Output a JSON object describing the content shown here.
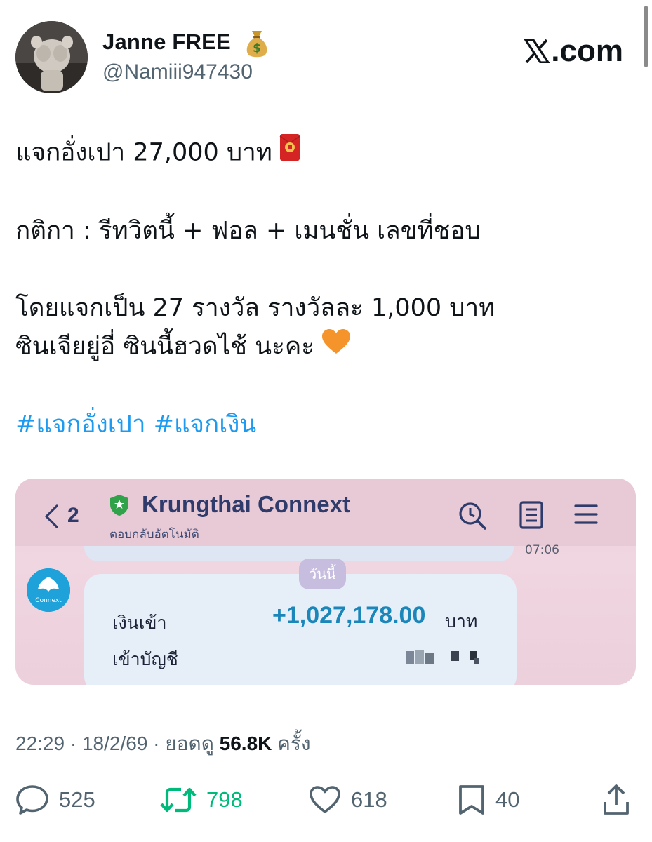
{
  "author": {
    "name": "Janne FREE",
    "name_emoji": "money-bag-icon",
    "handle": "@Namiii947430"
  },
  "brand": {
    "text": ".com",
    "logo": "x-logo-icon"
  },
  "tweet": {
    "line1": "แจกอั่งเปา 27,000 บาท",
    "line1_emoji": "red-envelope-icon",
    "line2": "กติกา : รีทวิตนี้ + ฟอล + เมนชั่น เลขที่ชอบ",
    "line3": "โดยแจกเป็น 27 รางวัล รางวัลละ 1,000 บาท",
    "line4": "ซินเจียยู่อี่ ซินนี้ฮวดไช้ นะคะ",
    "line4_emoji": "orange-heart-icon",
    "hashtags": "#แจกอั่งเปา #แจกเงิน"
  },
  "media": {
    "back_count": "2",
    "app_name": "Krungthai Connext",
    "app_subtitle": "ตอบกลับอัตโนมัติ",
    "time_partial": "07:06",
    "today_label": "วันนี้",
    "bot_label": "Connext",
    "deposit_label": "เงินเข้า",
    "amount": "+1,027,178.00",
    "amount_unit": "บาท",
    "account_label": "เข้าบัญชี",
    "colors": {
      "app_bar": "#e8c9d6",
      "title": "#2f3c6b",
      "amount": "#1a86b9"
    }
  },
  "meta": {
    "time": "22:29",
    "date": "18/2/69",
    "views_prefix": "ยอดดู",
    "views": "56.8K",
    "views_suffix": "ครั้ง"
  },
  "actions": {
    "replies": "525",
    "retweets": "798",
    "likes": "618",
    "bookmarks": "40"
  },
  "colors": {
    "link": "#1d9bf0",
    "secondary": "#536471",
    "retweet": "#00ba7c"
  }
}
